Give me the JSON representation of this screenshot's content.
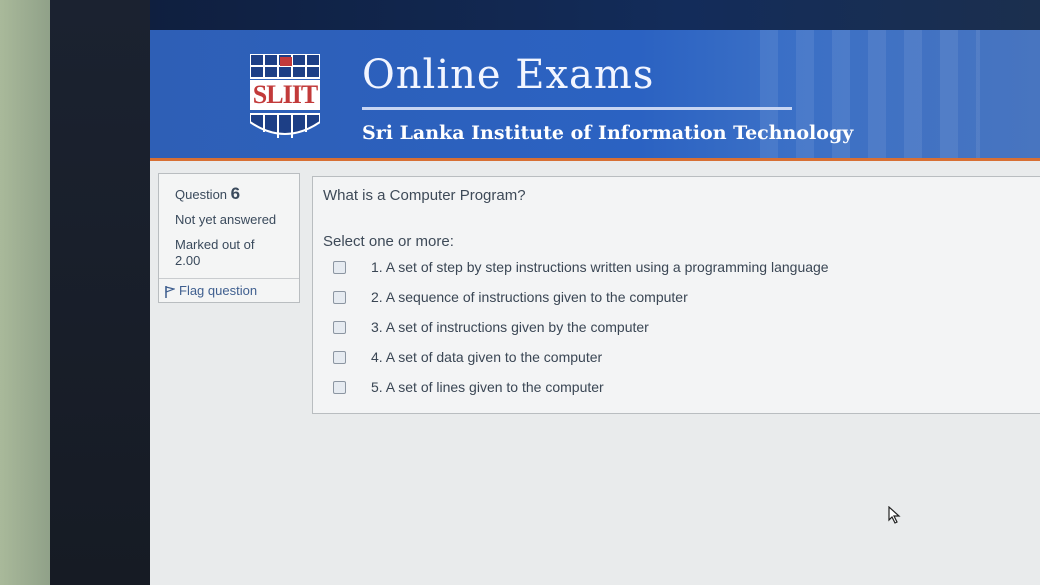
{
  "header": {
    "logo_text": "SLIIT",
    "title": "Online Exams",
    "subtitle": "Sri Lanka Institute of Information Technology",
    "colors": {
      "header_blue": "#2b62c2",
      "accent_orange": "#d76f34"
    }
  },
  "question_info": {
    "label": "Question",
    "number": "6",
    "state": "Not yet answered",
    "marked_label": "Marked out of",
    "marked_value": "2.00",
    "flag_label": "Flag question",
    "flag_icon": "flag-icon"
  },
  "question": {
    "text": "What is a Computer Program?",
    "prompt": "Select one or more:",
    "answers": [
      {
        "label": "1. A set of step by step instructions written using a programming language",
        "checked": false
      },
      {
        "label": "2. A sequence of instructions given to the computer",
        "checked": false
      },
      {
        "label": "3. A set of instructions given by the computer",
        "checked": false
      },
      {
        "label": "4. A set of data given to the computer",
        "checked": false
      },
      {
        "label": "5. A set of lines given to the computer",
        "checked": false
      }
    ]
  }
}
